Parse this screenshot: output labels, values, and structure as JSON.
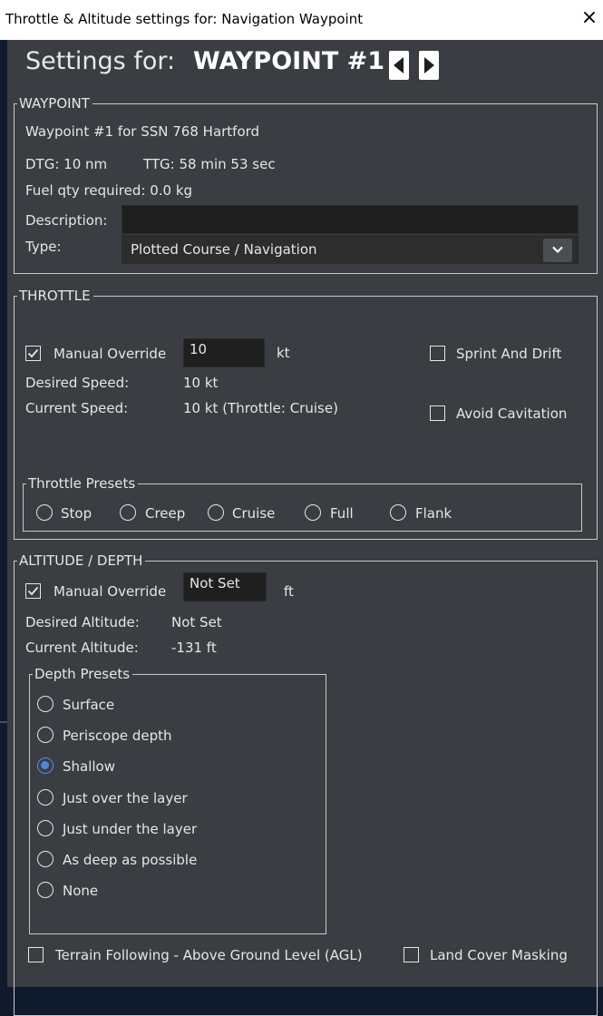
{
  "window": {
    "title": "Throttle & Altitude settings for: Navigation Waypoint",
    "close_icon": "×"
  },
  "header": {
    "prefix": "Settings for:",
    "name": "WAYPOINT #1"
  },
  "waypoint": {
    "legend": "WAYPOINT",
    "name": "Waypoint #1 for SSN 768 Hartford",
    "dtg": "DTG: 10 nm",
    "ttg": "TTG: 58 min 53 sec",
    "fuel": "Fuel qty required: 0.0 kg",
    "description_label": "Description:",
    "description_value": "",
    "type_label": "Type:",
    "type_value": "Plotted Course / Navigation"
  },
  "throttle": {
    "legend": "THROTTLE",
    "manual_override_label": "Manual Override",
    "manual_override_checked": true,
    "speed_input": "10",
    "speed_unit": "kt",
    "sprint_drift_label": "Sprint And Drift",
    "sprint_drift_checked": false,
    "avoid_cavitation_label": "Avoid Cavitation",
    "avoid_cavitation_checked": false,
    "desired_speed_label": "Desired Speed:",
    "desired_speed_value": "10 kt",
    "current_speed_label": "Current Speed:",
    "current_speed_value": "10 kt (Throttle: Cruise)",
    "presets_legend": "Throttle Presets",
    "presets": [
      "Stop",
      "Creep",
      "Cruise",
      "Full",
      "Flank"
    ],
    "preset_selected": null
  },
  "altitude": {
    "legend": "ALTITUDE / DEPTH",
    "manual_override_label": "Manual Override",
    "manual_override_checked": true,
    "altitude_input": "Not Set",
    "altitude_unit": "ft",
    "desired_label": "Desired Altitude:",
    "desired_value": "Not Set",
    "current_label": "Current Altitude:",
    "current_value": "-131 ft",
    "presets_legend": "Depth Presets",
    "presets": [
      "Surface",
      "Periscope depth",
      "Shallow",
      "Just over the layer",
      "Just under the layer",
      "As deep as possible",
      "None"
    ],
    "preset_selected": "Shallow",
    "terrain_following_label": "Terrain Following - Above Ground Level (AGL)",
    "terrain_following_checked": false,
    "land_cover_label": "Land Cover Masking",
    "land_cover_checked": false
  },
  "colors": {
    "panel": "#3a3d41",
    "field": "#1f1f1f",
    "accent": "#4f88db",
    "text": "#e6e6e6"
  },
  "icons": {
    "close": "close-icon",
    "prev": "arrow-left-icon",
    "next": "arrow-right-icon",
    "dropdown": "chevron-down-icon",
    "check": "checkmark-icon"
  }
}
